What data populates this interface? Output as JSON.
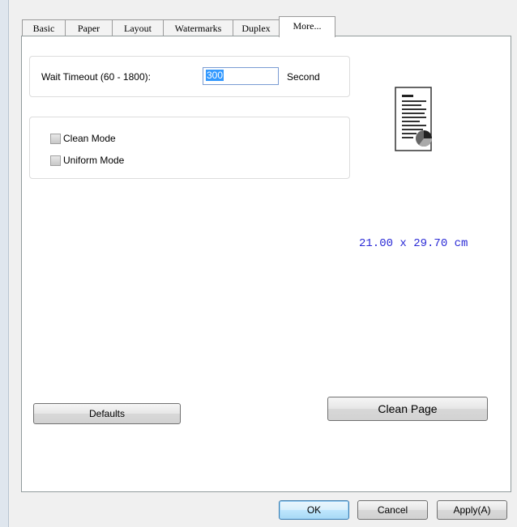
{
  "tabs": [
    "Basic",
    "Paper",
    "Layout",
    "Watermarks",
    "Duplex",
    "More..."
  ],
  "active_tab": "More...",
  "wait_timeout": {
    "label": "Wait Timeout (60 - 1800):",
    "value": "300",
    "unit": "Second"
  },
  "options": [
    {
      "label": "Clean Mode",
      "checked": false
    },
    {
      "label": "Uniform Mode",
      "checked": false
    }
  ],
  "paper_size": "21.00 x 29.70 cm",
  "buttons": {
    "defaults": "Defaults",
    "clean_page": "Clean Page"
  },
  "dialog_buttons": {
    "ok": "OK",
    "cancel": "Cancel",
    "apply": "Apply(A)"
  }
}
